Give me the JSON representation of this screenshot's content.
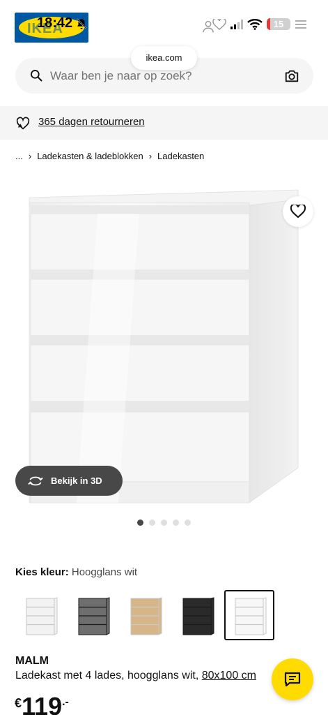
{
  "status_bar": {
    "time": "18:42",
    "battery": "15",
    "battery_fraction": 0.15,
    "icons": [
      "bell-off-icon",
      "signal-icon",
      "wifi-icon",
      "battery-icon"
    ]
  },
  "header": {
    "logo_text": "IKEA",
    "url": "ikea.com",
    "icons": [
      "profile-icon",
      "wishlist-icon",
      "cart-icon",
      "menu-icon"
    ]
  },
  "search": {
    "placeholder": "Waar ben je naar op zoek?",
    "icons": [
      "search-icon",
      "camera-icon"
    ]
  },
  "promo": {
    "returns_text": "365 dagen retourneren",
    "icon": "heart-return-icon"
  },
  "breadcrumb": {
    "items": [
      "...",
      "Ladekasten & ladeblokken",
      "Ladekasten"
    ],
    "separator": "›"
  },
  "gallery": {
    "view_3d_label": "Bekijk in 3D",
    "image_count": 5,
    "active_index": 0
  },
  "color_picker": {
    "label": "Kies kleur:",
    "selected_value": "Hoogglans wit",
    "swatches": [
      {
        "color": "#f2f2f2",
        "selected": false
      },
      {
        "color": "#6e6e6e",
        "selected": false
      },
      {
        "color": "#d6b689",
        "selected": false
      },
      {
        "color": "#2a2a2a",
        "selected": false
      },
      {
        "color": "#f7f7f7",
        "selected": true
      }
    ]
  },
  "product": {
    "name": "MALM",
    "description": "Ladekast met 4 lades, hoogglans wit, ",
    "size": "80x100 cm",
    "price_currency": "€",
    "price_amount": "119",
    "price_decimal": ".-"
  },
  "colors": {
    "ikea_blue": "#0058a3",
    "ikea_yellow": "#ffdb00",
    "dark_grey": "#484848",
    "battery_red": "#e53935"
  }
}
